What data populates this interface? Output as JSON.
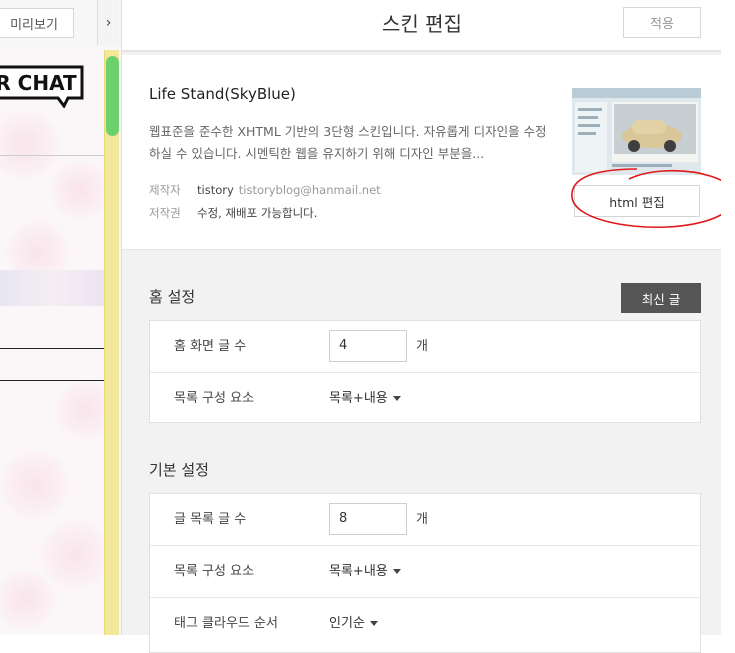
{
  "preview": {
    "button_label": "미리보기",
    "collapse_glyph": "›",
    "logo_text": "R CHAT"
  },
  "header": {
    "title": "스킨 편집",
    "apply_label": "적용"
  },
  "skin": {
    "name": "Life Stand(SkyBlue)",
    "description": "웹표준을 준수한 XHTML 기반의 3단형 스킨입니다. 자유롭게 디자인을 수정하실 수 있습니다. 시멘틱한 웹을 유지하기 위해 디자인 부분을...",
    "author_key": "제작자",
    "author_name": "tistory",
    "author_email": "tistoryblog@hanmail.net",
    "license_key": "저작권",
    "license_value": "수정, 재배포 가능합니다.",
    "html_edit_label": "html 편집"
  },
  "home_settings": {
    "title": "홈 설정",
    "recent_label": "최신 글",
    "posts_label": "홈 화면 글 수",
    "posts_value": "4",
    "posts_unit": "개",
    "list_label": "목록 구성 요소",
    "list_value": "목록+내용"
  },
  "basic_settings": {
    "title": "기본 설정",
    "posts_label": "글 목록 글 수",
    "posts_value": "8",
    "posts_unit": "개",
    "list_label": "목록 구성 요소",
    "list_value": "목록+내용",
    "tag_label": "태그 클라우드 순서",
    "tag_value": "인기순"
  },
  "colors": {
    "accent_dark": "#555555",
    "scroll_thumb": "#6cd16c",
    "scroll_track": "#f3e89a",
    "annotation": "#e0191a"
  }
}
